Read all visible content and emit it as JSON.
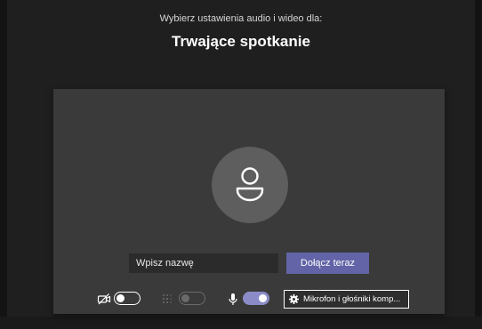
{
  "header": {
    "subtitle": "Wybierz ustawienia audio i wideo dla:",
    "title": "Trwające spotkanie"
  },
  "join": {
    "name_placeholder": "Wpisz nazwę",
    "join_label": "Dołącz teraz"
  },
  "controls": {
    "camera": {
      "icon": "camera-off-icon",
      "state": "off"
    },
    "background_blur": {
      "icon": "blur-icon",
      "state": "disabled"
    },
    "microphone": {
      "icon": "microphone-icon",
      "state": "on"
    },
    "device_settings": {
      "icon": "gear-icon",
      "label": "Mikrofon i głośniki komp..."
    }
  },
  "colors": {
    "accent": "#6264a7",
    "toggle_on": "#8b8cc7",
    "background": "#1f1f1f",
    "card": "#3a3a3a"
  }
}
